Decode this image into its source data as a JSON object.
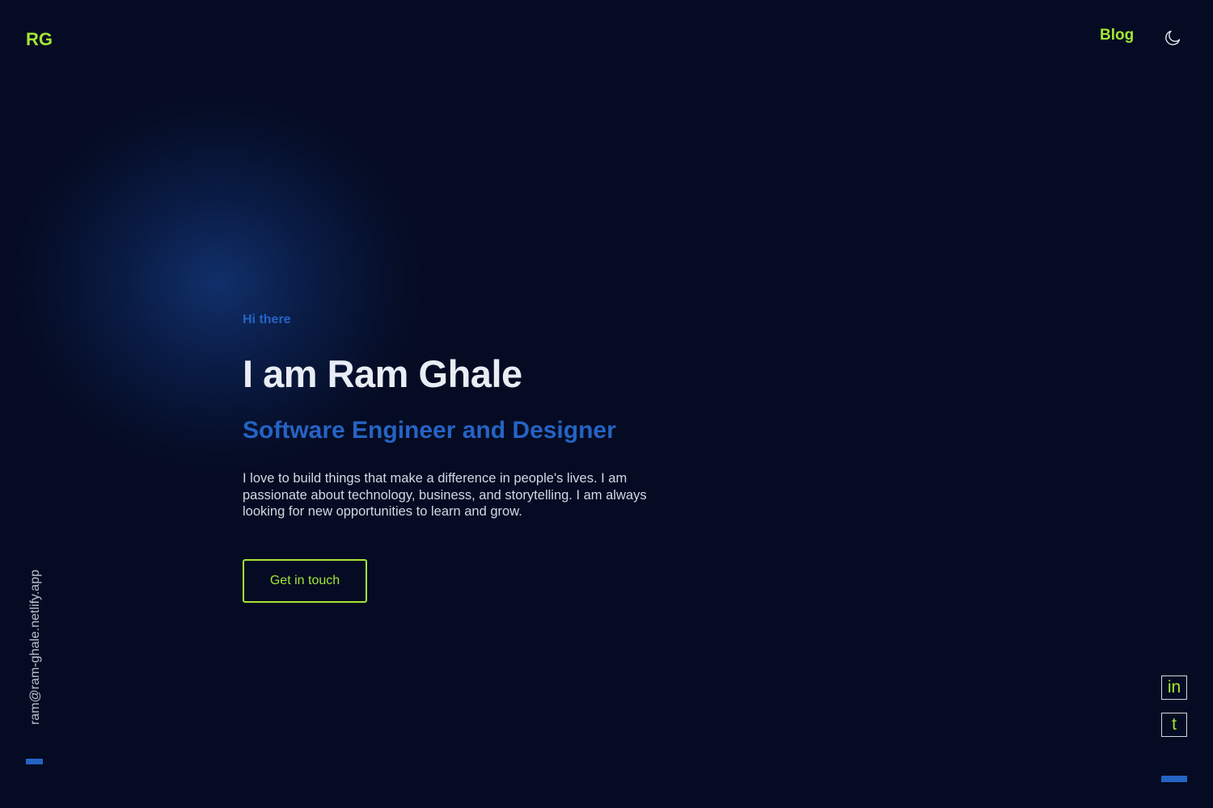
{
  "header": {
    "logo": "RG",
    "nav_blog": "Blog",
    "theme_toggle_icon": "moon-icon"
  },
  "hero": {
    "greeting": "Hi there",
    "name": "I am Ram Ghale",
    "role": "Software Engineer and Designer",
    "bio": "I love to build things that make a difference in people's lives. I am passionate about technology, business, and storytelling. I am always looking for new opportunities to learn and grow.",
    "cta_label": "Get in touch"
  },
  "sidebar_left": {
    "email": "ram@ram-ghale.netlify.app"
  },
  "sidebar_right": {
    "social": [
      {
        "name": "linkedin-icon",
        "glyph": "in"
      },
      {
        "name": "twitter-icon",
        "glyph": "t"
      }
    ]
  },
  "colors": {
    "background": "#050b22",
    "accent_lime": "#a3e635",
    "accent_blue": "#2563c4",
    "heading": "#e8edf5",
    "body_text": "#d2d8e4"
  }
}
